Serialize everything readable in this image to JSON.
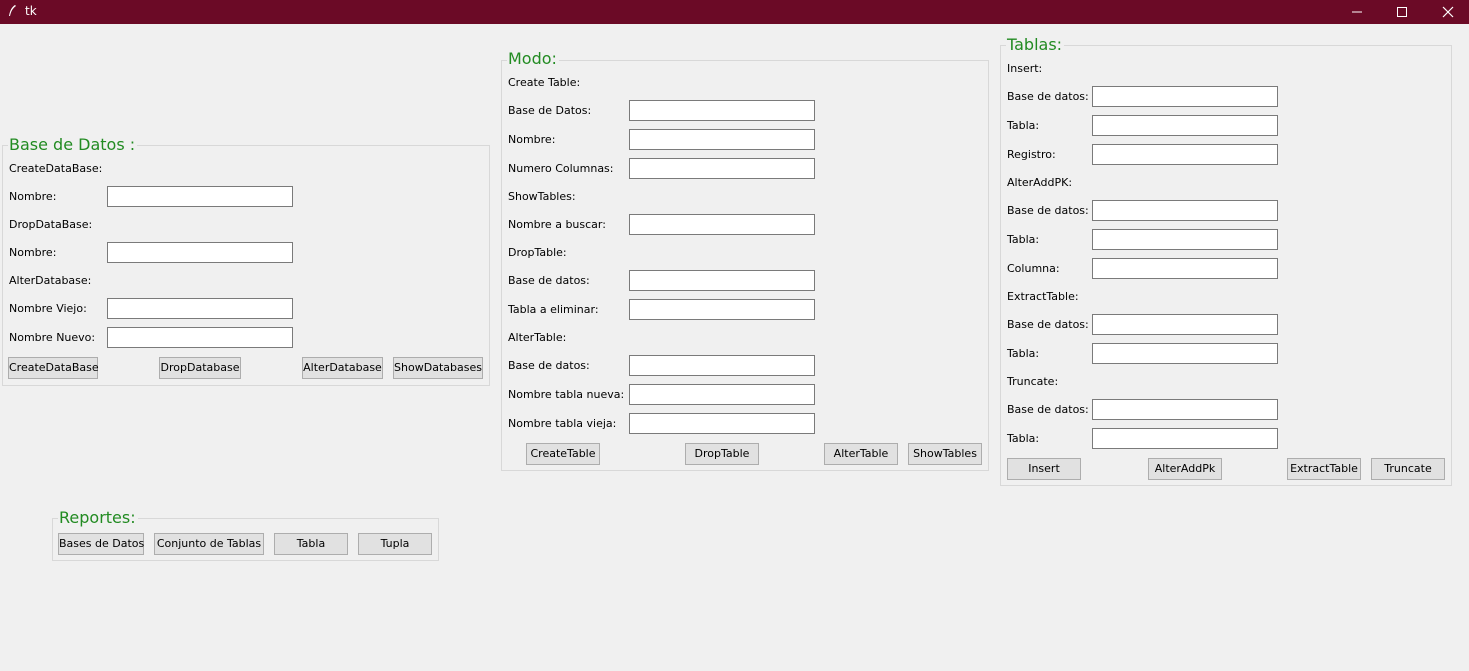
{
  "window": {
    "title": "tk",
    "theme_color": "#6b0a26",
    "group_title_color": "#228b22"
  },
  "base_de_datos": {
    "title": "Base de Datos :",
    "create_header": "CreateDataBase:",
    "create_nombre_label": "Nombre:",
    "drop_header": "DropDataBase:",
    "drop_nombre_label": "Nombre:",
    "alter_header": "AlterDatabase:",
    "nombre_viejo_label": "Nombre Viejo:",
    "nombre_nuevo_label": "Nombre Nuevo:",
    "buttons": {
      "create": "CreateDataBase",
      "drop": "DropDatabase",
      "alter": "AlterDatabase",
      "show": "ShowDatabases"
    }
  },
  "modo": {
    "title": "Modo:",
    "create_header": "Create Table:",
    "base_label": "Base de Datos:",
    "nombre_label": "Nombre:",
    "numero_columnas_label": "Numero Columnas:",
    "show_header": "ShowTables:",
    "nombre_buscar_label": "Nombre a buscar:",
    "drop_header": "DropTable:",
    "drop_base_label": "Base de datos:",
    "tabla_eliminar_label": "Tabla a eliminar:",
    "alter_header": "AlterTable:",
    "alter_base_label": "Base de datos:",
    "nombre_tabla_nueva_label": "Nombre tabla nueva:",
    "nombre_tabla_vieja_label": "Nombre tabla vieja:",
    "buttons": {
      "create": "CreateTable",
      "drop": "DropTable",
      "alter": "AlterTable",
      "show": "ShowTables"
    }
  },
  "tablas": {
    "title": "Tablas:",
    "insert_header": "Insert:",
    "insert_base_label": "Base de datos:",
    "insert_tabla_label": "Tabla:",
    "registro_label": "Registro:",
    "alteraddpk_header": "AlterAddPK:",
    "pk_base_label": "Base de datos:",
    "pk_tabla_label": "Tabla:",
    "columna_label": "Columna:",
    "extract_header": "ExtractTable:",
    "extract_base_label": "Base de datos:",
    "extract_tabla_label": "Tabla:",
    "truncate_header": "Truncate:",
    "truncate_base_label": "Base de datos:",
    "truncate_tabla_label": "Tabla:",
    "buttons": {
      "insert": "Insert",
      "alteraddpk": "AlterAddPk",
      "extract": "ExtractTable",
      "truncate": "Truncate"
    }
  },
  "reportes": {
    "title": "Reportes:",
    "buttons": {
      "bases": "Bases de Datos",
      "conjunto": "Conjunto de Tablas",
      "tabla": "Tabla",
      "tupla": "Tupla"
    }
  }
}
